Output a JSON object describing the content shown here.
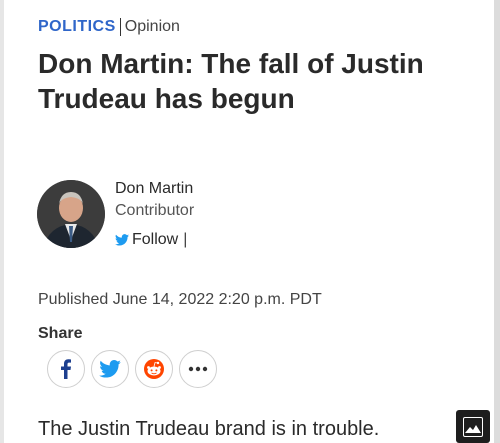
{
  "article": {
    "category": "POLITICS",
    "type": "Opinion",
    "headline": "Don Martin: The fall of Justin Trudeau has begun",
    "published": "Published June 14, 2022 2:20 p.m. PDT",
    "lede": "The Justin Trudeau brand is in trouble."
  },
  "author": {
    "name": "Don Martin",
    "role": "Contributor",
    "follow_label": "Follow",
    "follow_separator": "|"
  },
  "share": {
    "label": "Share",
    "buttons": [
      {
        "icon": "facebook-icon",
        "color": "#1d3f8f"
      },
      {
        "icon": "twitter-icon",
        "color": "#1d9bf0"
      },
      {
        "icon": "reddit-icon",
        "color": "#ff4500"
      },
      {
        "icon": "more-icon",
        "color": "#333333"
      }
    ]
  },
  "colors": {
    "accent": "#2f66c9",
    "text": "#2a2a2a"
  }
}
